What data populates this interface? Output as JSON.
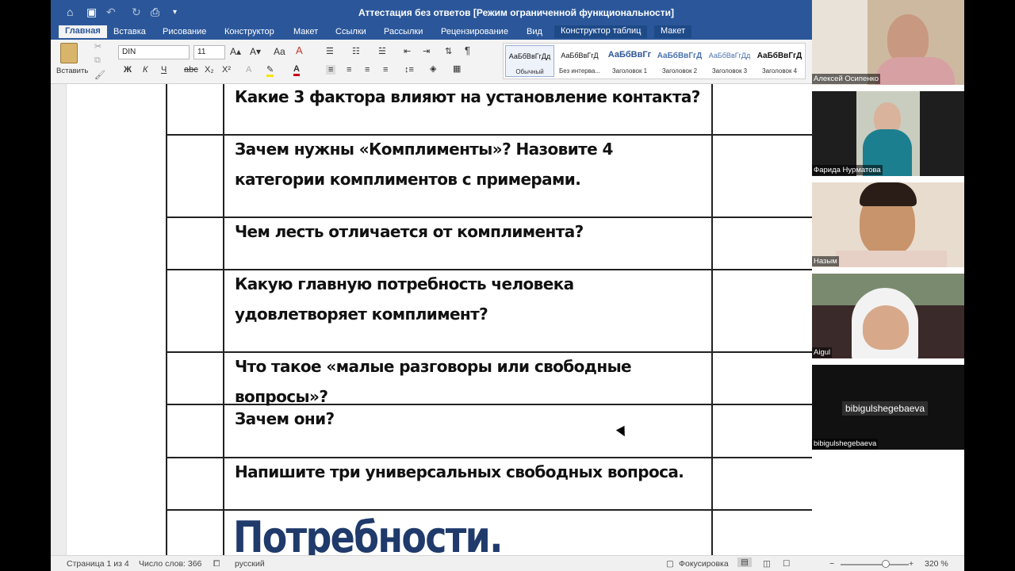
{
  "window": {
    "title": "Аттестация без ответов [Режим ограниченной функциональности]"
  },
  "tabs": [
    "Главная",
    "Вставка",
    "Рисование",
    "Конструктор",
    "Макет",
    "Ссылки",
    "Рассылки",
    "Рецензирование",
    "Вид",
    "Конструктор таблиц",
    "Макет"
  ],
  "ribbon": {
    "paste_label": "Вставить",
    "font_name": "DIN",
    "font_size": "11",
    "styles": [
      {
        "sample": "АаБбВвГгДд",
        "name": "Обычный"
      },
      {
        "sample": "АаБбВвГгД",
        "name": "Без интерва..."
      },
      {
        "sample": "АаБбВвГг",
        "name": "Заголовок 1"
      },
      {
        "sample": "АаБбВвГгД",
        "name": "Заголовок 2"
      },
      {
        "sample": "АаБбВвГгДд",
        "name": "Заголовок 3"
      },
      {
        "sample": "АаБбВвГгД",
        "name": "Заголовок 4"
      }
    ]
  },
  "document": {
    "questions": [
      "Какие 3 фактора влияют на установление контакта?",
      "Зачем нужны «Комплименты»? Назовите 4 категории комплиментов с примерами.",
      "Чем лесть отличается от комплимента?",
      "Какую главную потребность человека удовлетворяет комплимент?",
      "Что такое «малые разговоры или свободные вопросы»?",
      "Зачем они?",
      "Напишите три универсальных свободных вопроса."
    ],
    "heading": "Потребности."
  },
  "status": {
    "page": "Страница 1 из 4",
    "words": "Число слов: 366",
    "language": "русский",
    "focus": "Фокусировка",
    "zoom": "320 %"
  },
  "participants": [
    {
      "name": "Алексей Осипенко"
    },
    {
      "name": "Фарида Нурматова"
    },
    {
      "name": "Назым"
    },
    {
      "name": "Aigul"
    },
    {
      "name": "bibigulshegebaeva",
      "screen_label": "bibigulshegebaeva"
    }
  ]
}
